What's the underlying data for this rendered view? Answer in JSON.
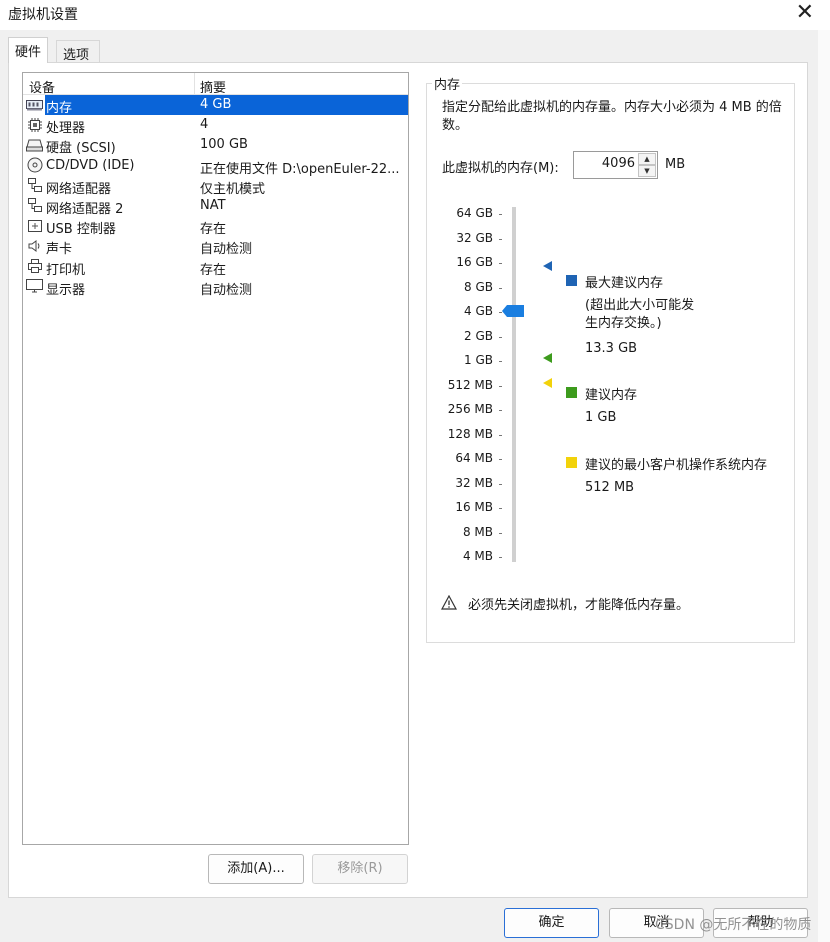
{
  "window": {
    "title": "虚拟机设置"
  },
  "tabs": [
    {
      "label": "硬件"
    },
    {
      "label": "选项"
    }
  ],
  "device_list": {
    "columns": [
      "设备",
      "摘要"
    ],
    "rows": [
      {
        "name": "内存",
        "summary": "4 GB",
        "icon": "memory-icon"
      },
      {
        "name": "处理器",
        "summary": "4",
        "icon": "processor-icon"
      },
      {
        "name": "硬盘 (SCSI)",
        "summary": "100 GB",
        "icon": "harddisk-icon"
      },
      {
        "name": "CD/DVD (IDE)",
        "summary": "正在使用文件 D:\\openEuler-22...",
        "icon": "cdrom-icon"
      },
      {
        "name": "网络适配器",
        "summary": "仅主机模式",
        "icon": "network-icon"
      },
      {
        "name": "网络适配器 2",
        "summary": "NAT",
        "icon": "network-icon"
      },
      {
        "name": "USB 控制器",
        "summary": "存在",
        "icon": "usb-icon"
      },
      {
        "name": "声卡",
        "summary": "自动检测",
        "icon": "speaker-icon"
      },
      {
        "name": "打印机",
        "summary": "存在",
        "icon": "printer-icon"
      },
      {
        "name": "显示器",
        "summary": "自动检测",
        "icon": "monitor-icon"
      }
    ]
  },
  "list_buttons": {
    "add": "添加(A)...",
    "remove": "移除(R)"
  },
  "memory": {
    "group_label": "内存",
    "description": "指定分配给此虚拟机的内存量。内存大小必须为 4 MB 的倍数。",
    "input_label": "此虚拟机的内存(M):",
    "value": "4096",
    "unit": "MB",
    "scale": [
      "64 GB",
      "32 GB",
      "16 GB",
      "8 GB",
      "4 GB",
      "2 GB",
      "1 GB",
      "512 MB",
      "256 MB",
      "128 MB",
      "64 MB",
      "32 MB",
      "16 MB",
      "8 MB",
      "4 MB"
    ],
    "legend": {
      "max": {
        "label": "最大建议内存",
        "note": "(超出此大小可能发生内存交换。)",
        "value": "13.3 GB",
        "color": "#1f64b4"
      },
      "recommended": {
        "label": "建议内存",
        "value": "1 GB",
        "color": "#3d9b1d"
      },
      "min": {
        "label": "建议的最小客户机操作系统内存",
        "value": "512 MB",
        "color": "#f2d20a"
      }
    },
    "slider_color": "#1a7ee0",
    "warning": "必须先关闭虚拟机，才能降低内存量。"
  },
  "footer_buttons": {
    "ok": "确定",
    "cancel": "取消",
    "help": "帮助"
  },
  "watermark": "CSDN @无所不在的物质"
}
